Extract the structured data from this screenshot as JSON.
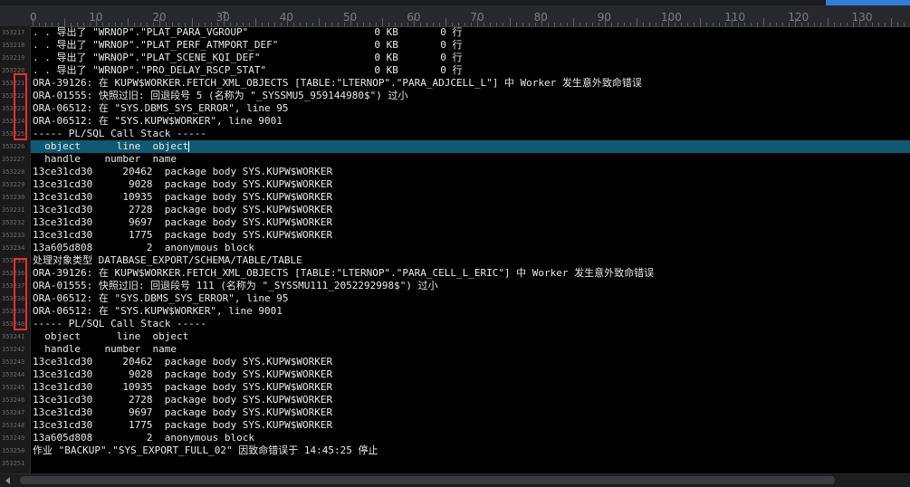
{
  "ruler": {
    "labels": [
      "0",
      "10",
      "20",
      "30",
      "40",
      "50",
      "60",
      "70",
      "80",
      "90",
      "100",
      "110",
      "120",
      "130"
    ],
    "marker": "T"
  },
  "gutter": {
    "line_numbers": [
      "353217",
      "353218",
      "353219",
      "353220",
      "353221",
      "353222",
      "353223",
      "353224",
      "353225",
      "353226",
      "353227",
      "353228",
      "353229",
      "353230",
      "353231",
      "353232",
      "353233",
      "353234",
      "353235",
      "353236",
      "353237",
      "353238",
      "353239",
      "353240",
      "353241",
      "353242",
      "353243",
      "353244",
      "353245",
      "353246",
      "353247",
      "353248",
      "353249",
      "353250",
      "353251"
    ]
  },
  "editor": {
    "current_line_index": 9,
    "lines": [
      ". . 导出了 \"WRNOP\".\"PLAT_PARA_VGROUP\"                     0 KB       0 行",
      ". . 导出了 \"WRNOP\".\"PLAT_PERF_ATMPORT_DEF\"                0 KB       0 行",
      ". . 导出了 \"WRNOP\".\"PLAT_SCENE_KQI_DEF\"                   0 KB       0 行",
      ". . 导出了 \"WRNOP\".\"PRO_DELAY_RSCP_STAT\"                  0 KB       0 行",
      "ORA-39126: 在 KUPW$WORKER.FETCH_XML_OBJECTS [TABLE:\"LTERNOP\".\"PARA_ADJCELL_L\"] 中 Worker 发生意外致命错误",
      "ORA-01555: 快照过旧: 回退段号 5 (名称为 \"_SYSSMU5_959144980$\") 过小",
      "ORA-06512: 在 \"SYS.DBMS_SYS_ERROR\", line 95",
      "ORA-06512: 在 \"SYS.KUPW$WORKER\", line 9001",
      "----- PL/SQL Call Stack -----",
      "  object      line  object",
      "  handle    number  name",
      "13ce31cd30     20462  package body SYS.KUPW$WORKER",
      "13ce31cd30      9028  package body SYS.KUPW$WORKER",
      "13ce31cd30     10935  package body SYS.KUPW$WORKER",
      "13ce31cd30      2728  package body SYS.KUPW$WORKER",
      "13ce31cd30      9697  package body SYS.KUPW$WORKER",
      "13ce31cd30      1775  package body SYS.KUPW$WORKER",
      "13a605d808         2  anonymous block",
      "处理对象类型 DATABASE_EXPORT/SCHEMA/TABLE/TABLE",
      "ORA-39126: 在 KUPW$WORKER.FETCH_XML_OBJECTS [TABLE:\"LTERNOP\".\"PARA_CELL_L_ERIC\"] 中 Worker 发生意外致命错误",
      "ORA-01555: 快照过旧: 回退段号 111 (名称为 \"_SYSSMU111_2052292998$\") 过小",
      "ORA-06512: 在 \"SYS.DBMS_SYS_ERROR\", line 95",
      "ORA-06512: 在 \"SYS.KUPW$WORKER\", line 9001",
      "----- PL/SQL Call Stack -----",
      "  object      line  object",
      "  handle    number  name",
      "13ce31cd30     20462  package body SYS.KUPW$WORKER",
      "13ce31cd30      9028  package body SYS.KUPW$WORKER",
      "13ce31cd30     10935  package body SYS.KUPW$WORKER",
      "13ce31cd30      2728  package body SYS.KUPW$WORKER",
      "13ce31cd30      9697  package body SYS.KUPW$WORKER",
      "13ce31cd30      1775  package body SYS.KUPW$WORKER",
      "13a605d808         2  anonymous block",
      "作业 \"BACKUP\".\"SYS_EXPORT_FULL_02\" 因致命错误于 14:45:25 停止",
      ""
    ]
  },
  "colors": {
    "background": "#000000",
    "text": "#e8e8e8",
    "current_line": "#0e5a73",
    "highlight_box": "#ff2b2b",
    "scroll_accent": "#2f7fd8"
  },
  "icons": {
    "scroll_left": "triangle-left-icon"
  }
}
